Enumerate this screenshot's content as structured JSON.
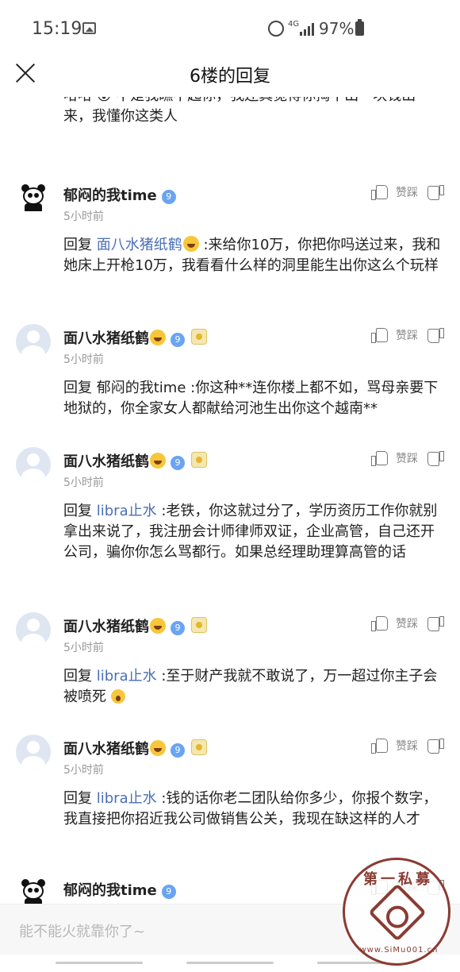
{
  "status_bar": {
    "time": "15:19",
    "network": "4G",
    "battery": "97%"
  },
  "header": {
    "title": "6楼的回复"
  },
  "top_partial_text": "哈哈 😮 不是我瞧不起你，我还真觉得你掏不出一块钱出来，我懂你这类人",
  "vote_label": "赞踩",
  "comments": [
    {
      "username": "郁闷的我time",
      "vip_level": "9",
      "avatar": "panda",
      "time": "5小时前",
      "reply_prefix": "回复",
      "mention": "面八水猪纸鹤",
      "text": ":来给你10万，你把你吗送过来，我和她床上开枪10万，我看看什么样的洞里能生出你这么个玩样"
    },
    {
      "username": "面八水猪纸鹤",
      "vip_level": "9",
      "avatar": "default",
      "time": "5小时前",
      "reply_prefix": "回复",
      "mention": "郁闷的我time",
      "text": ":你这种**连你楼上都不如，骂母亲要下地狱的，你全家女人都献给河池生出你这个越南**"
    },
    {
      "username": "面八水猪纸鹤",
      "vip_level": "9",
      "avatar": "default",
      "time": "5小时前",
      "reply_prefix": "回复",
      "mention": "libra止水",
      "text": ":老铁，你这就过分了，学历资历工作你就别拿出来说了，我注册会计师律师双证，企业高管，自己还开公司，骗你你怎么骂都行。如果总经理助理算高管的话"
    },
    {
      "username": "面八水猪纸鹤",
      "vip_level": "9",
      "avatar": "default",
      "time": "5小时前",
      "reply_prefix": "回复",
      "mention": "libra止水",
      "text": ":至于财产我就不敢说了，万一超过你主子会被喷死"
    },
    {
      "username": "面八水猪纸鹤",
      "vip_level": "9",
      "avatar": "default",
      "time": "5小时前",
      "reply_prefix": "回复",
      "mention": "libra止水",
      "text": ":钱的话你老二团队给你多少，你报个数字，我直接把你招近我公司做销售公关，我现在缺这样的人才"
    },
    {
      "username": "郁闷的我time",
      "vip_level": "9",
      "avatar": "panda"
    }
  ],
  "input": {
    "placeholder": "能不能火就靠你了~"
  },
  "watermark": {
    "top_text": "第一私募",
    "bottom_text": "www.SiMu001.cn"
  },
  "colors": {
    "mention": "#4a6fb5",
    "vip_badge": "#6aa4f2",
    "watermark": "#8a3b33"
  }
}
